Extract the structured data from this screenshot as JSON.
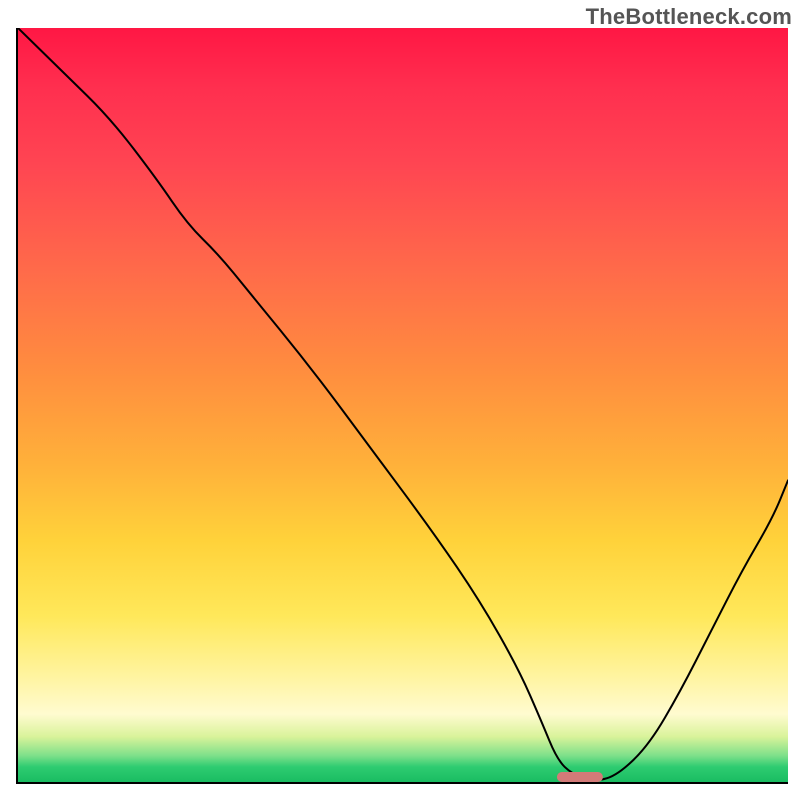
{
  "watermark": "TheBottleneck.com",
  "chart_data": {
    "type": "line",
    "title": "",
    "xlabel": "",
    "ylabel": "",
    "xlim": [
      0,
      100
    ],
    "ylim": [
      0,
      100
    ],
    "grid": false,
    "legend": false,
    "background_gradient": {
      "top": "#ff1744",
      "mid": "#ffd23a",
      "bottom": "#1abc62"
    },
    "marker": {
      "x": 73,
      "y": 0,
      "width_pct": 6,
      "color": "#d37a78"
    },
    "series": [
      {
        "name": "bottleneck-curve",
        "x": [
          0,
          6,
          12,
          18,
          22,
          26,
          30,
          38,
          46,
          54,
          60,
          65,
          68,
          70,
          72,
          75,
          78,
          82,
          86,
          90,
          94,
          98,
          100
        ],
        "y": [
          100,
          94,
          88,
          80,
          74,
          70,
          65,
          55,
          44,
          33,
          24,
          15,
          8,
          3,
          1,
          0,
          1,
          5,
          12,
          20,
          28,
          35,
          40
        ]
      }
    ]
  }
}
